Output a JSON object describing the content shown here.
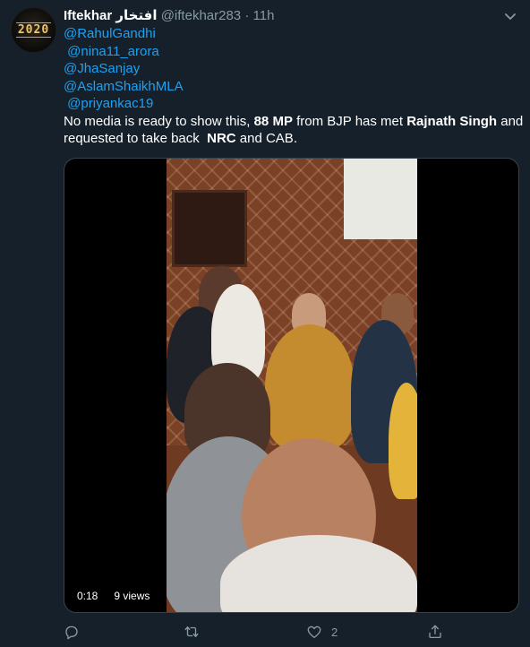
{
  "tweet": {
    "avatar_text": "2020",
    "author_name": "Iftekhar",
    "author_name_alt": "افتخار",
    "handle": "@iftekhar283",
    "separator": "·",
    "time": "11h",
    "mentions": [
      "@RahulGandhi",
      "@nina11_arora",
      "@JhaSanjay",
      "@AslamShaikhMLA",
      "@priyankac19"
    ],
    "text": {
      "part1": "No media is ready to show this, ",
      "bold1": "88 MP",
      "part2": " from BJP has met ",
      "bold2": "Rajnath Singh",
      "part3": " and",
      "part4": "requested to take back  ",
      "bold3": "NRC",
      "part5": " and CAB."
    },
    "video": {
      "duration": "0:18",
      "views": "9 views"
    },
    "actions": {
      "reply_count": "",
      "retweet_count": "",
      "like_count": "2"
    },
    "colors": {
      "background": "#15202b",
      "link": "#1da1f2",
      "muted": "#8899a6"
    }
  }
}
